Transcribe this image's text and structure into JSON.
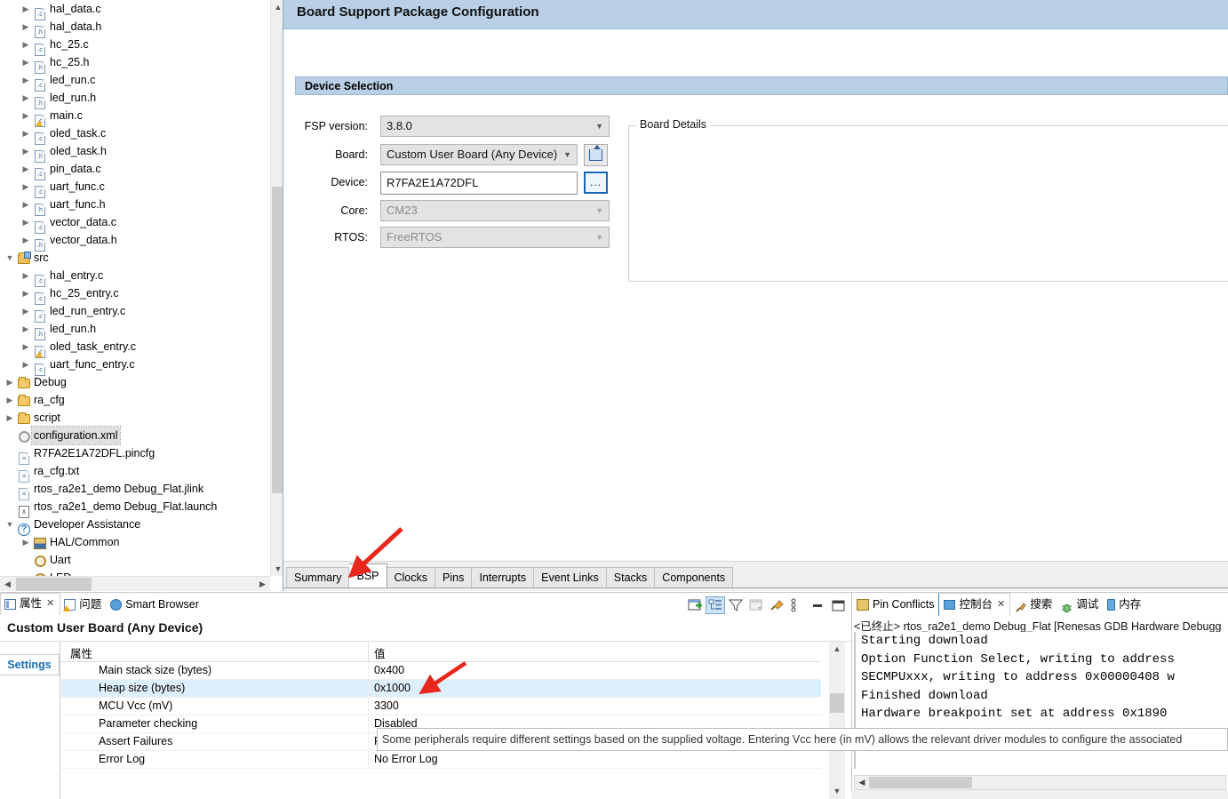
{
  "tree": {
    "items": [
      {
        "label": "hal_data.c",
        "icon": "c-file-icon",
        "indent": 2,
        "twist": "collapsed"
      },
      {
        "label": "hal_data.h",
        "icon": "h-file-icon",
        "indent": 2,
        "twist": "collapsed"
      },
      {
        "label": "hc_25.c",
        "icon": "c-file-icon",
        "indent": 2,
        "twist": "collapsed"
      },
      {
        "label": "hc_25.h",
        "icon": "h-file-icon",
        "indent": 2,
        "twist": "collapsed"
      },
      {
        "label": "led_run.c",
        "icon": "c-file-icon",
        "indent": 2,
        "twist": "collapsed"
      },
      {
        "label": "led_run.h",
        "icon": "h-file-icon",
        "indent": 2,
        "twist": "collapsed"
      },
      {
        "label": "main.c",
        "icon": "c-file-warning-icon",
        "indent": 2,
        "twist": "collapsed"
      },
      {
        "label": "oled_task.c",
        "icon": "c-file-icon",
        "indent": 2,
        "twist": "collapsed"
      },
      {
        "label": "oled_task.h",
        "icon": "h-file-icon",
        "indent": 2,
        "twist": "collapsed"
      },
      {
        "label": "pin_data.c",
        "icon": "c-file-icon",
        "indent": 2,
        "twist": "collapsed"
      },
      {
        "label": "uart_func.c",
        "icon": "c-file-icon",
        "indent": 2,
        "twist": "collapsed"
      },
      {
        "label": "uart_func.h",
        "icon": "h-file-icon",
        "indent": 2,
        "twist": "collapsed"
      },
      {
        "label": "vector_data.c",
        "icon": "c-file-icon",
        "indent": 2,
        "twist": "collapsed"
      },
      {
        "label": "vector_data.h",
        "icon": "h-file-icon",
        "indent": 2,
        "twist": "collapsed"
      },
      {
        "label": "src",
        "icon": "source-folder-icon",
        "indent": 1,
        "twist": "expanded"
      },
      {
        "label": "hal_entry.c",
        "icon": "c-file-icon",
        "indent": 2,
        "twist": "collapsed"
      },
      {
        "label": "hc_25_entry.c",
        "icon": "c-file-icon",
        "indent": 2,
        "twist": "collapsed"
      },
      {
        "label": "led_run_entry.c",
        "icon": "c-file-icon",
        "indent": 2,
        "twist": "collapsed"
      },
      {
        "label": "led_run.h",
        "icon": "h-file-icon",
        "indent": 2,
        "twist": "collapsed"
      },
      {
        "label": "oled_task_entry.c",
        "icon": "c-file-warning-icon",
        "indent": 2,
        "twist": "collapsed"
      },
      {
        "label": "uart_func_entry.c",
        "icon": "c-file-icon",
        "indent": 2,
        "twist": "collapsed"
      },
      {
        "label": "Debug",
        "icon": "folder-icon",
        "indent": 1,
        "twist": "collapsed"
      },
      {
        "label": "ra_cfg",
        "icon": "folder-icon",
        "indent": 1,
        "twist": "collapsed"
      },
      {
        "label": "script",
        "icon": "folder-icon",
        "indent": 1,
        "twist": "collapsed"
      },
      {
        "label": "configuration.xml",
        "icon": "gear-grey-icon",
        "indent": 1,
        "twist": "none",
        "selected": true
      },
      {
        "label": "R7FA2E1A72DFL.pincfg",
        "icon": "document-icon",
        "indent": 1,
        "twist": "none"
      },
      {
        "label": "ra_cfg.txt",
        "icon": "document-icon",
        "indent": 1,
        "twist": "none"
      },
      {
        "label": "rtos_ra2e1_demo Debug_Flat.jlink",
        "icon": "document-icon",
        "indent": 1,
        "twist": "none"
      },
      {
        "label": "rtos_ra2e1_demo Debug_Flat.launch",
        "icon": "launch-file-icon",
        "indent": 1,
        "twist": "none"
      },
      {
        "label": "Developer Assistance",
        "icon": "question-icon",
        "indent": 1,
        "twist": "expanded"
      },
      {
        "label": "HAL/Common",
        "icon": "hal-icon",
        "indent": 2,
        "twist": "collapsed"
      },
      {
        "label": "Uart",
        "icon": "gear-icon",
        "indent": 2,
        "twist": "none"
      },
      {
        "label": "LED",
        "icon": "gear-icon",
        "indent": 2,
        "twist": "none"
      }
    ]
  },
  "editor": {
    "title": "Board Support Package Configuration",
    "device_selection": {
      "group_title": "Device Selection",
      "fields": [
        {
          "label": "FSP version:",
          "value": "3.8.0",
          "kind": "combo",
          "disabled": false
        },
        {
          "label": "Board:",
          "value": "Custom User Board (Any Device)",
          "kind": "combo",
          "disabled": false
        },
        {
          "label": "Device:",
          "value": "R7FA2E1A72DFL",
          "kind": "text"
        },
        {
          "label": "Core:",
          "value": "CM23",
          "kind": "combo",
          "disabled": true
        },
        {
          "label": "RTOS:",
          "value": "FreeRTOS",
          "kind": "combo",
          "disabled": true
        }
      ],
      "import_button_label": "",
      "browse_button_label": "..."
    },
    "board_details": {
      "legend": "Board Details",
      "content": ""
    },
    "tabs": [
      {
        "label": "Summary",
        "active": false
      },
      {
        "label": "BSP",
        "active": true
      },
      {
        "label": "Clocks",
        "active": false
      },
      {
        "label": "Pins",
        "active": false
      },
      {
        "label": "Interrupts",
        "active": false
      },
      {
        "label": "Event Links",
        "active": false
      },
      {
        "label": "Stacks",
        "active": false
      },
      {
        "label": "Components",
        "active": false
      }
    ]
  },
  "properties_view": {
    "tabs": [
      {
        "label": "属性",
        "icon": "properties-icon",
        "active": true,
        "closable": true
      },
      {
        "label": "问题",
        "icon": "problems-icon",
        "active": false,
        "closable": false
      },
      {
        "label": "Smart Browser",
        "icon": "globe-icon",
        "active": false,
        "closable": false
      }
    ],
    "title": "Custom User Board (Any Device)",
    "settings_tab_label": "Settings",
    "columns": [
      "属性",
      "值"
    ],
    "rows": [
      {
        "name": "Main stack size (bytes)",
        "value": "0x400",
        "highlight": false
      },
      {
        "name": "Heap size (bytes)",
        "value": "0x1000",
        "highlight": true
      },
      {
        "name": "MCU Vcc (mV)",
        "value": "3300",
        "highlight": false
      },
      {
        "name": "Parameter checking",
        "value": "Disabled",
        "highlight": false
      },
      {
        "name": "Assert Failures",
        "value": "Return FSP_ERR_ASSERTION",
        "highlight": false
      },
      {
        "name": "Error Log",
        "value": "No Error Log",
        "highlight": false
      }
    ],
    "toolbar_icons": [
      "new-properties-view-icon",
      "show-categories-icon",
      "filter-icon",
      "restore-default-icon",
      "pin-icon",
      "view-menu-icon",
      "minimize-icon",
      "maximize-icon"
    ],
    "tooltip": "Some peripherals require different settings based on the supplied voltage. Entering Vcc here (in mV) allows the relevant driver modules to configure the associated"
  },
  "console_view": {
    "tabs": [
      {
        "label": "Pin Conflicts",
        "icon": "pin-conflicts-icon",
        "active": false,
        "closable": false
      },
      {
        "label": "控制台",
        "icon": "console-icon",
        "active": true,
        "closable": true
      },
      {
        "label": "搜索",
        "icon": "search-icon",
        "active": false,
        "closable": false
      },
      {
        "label": "调试",
        "icon": "debug-icon",
        "active": false,
        "closable": false
      },
      {
        "label": "内存",
        "icon": "memory-icon",
        "active": false,
        "closable": false
      }
    ],
    "subtitle": "<已终止> rtos_ra2e1_demo Debug_Flat [Renesas GDB Hardware Debugg",
    "output": "Starting download\nOption Function Select, writing to address\nSECMPUxxx, writing to address 0x00000408 w\nFinished download\nHardware breakpoint set at address 0x1890"
  },
  "annotations": {
    "arrow_color": "#e8261c",
    "arrow_to_bsp_tab": "points at BSP tab",
    "arrow_to_heap_row": "points at Heap size value"
  },
  "colors": {
    "header_blue": "#b8cfe5",
    "row_highlight": "#ddeefc",
    "accent_link": "#1a6fb5"
  }
}
